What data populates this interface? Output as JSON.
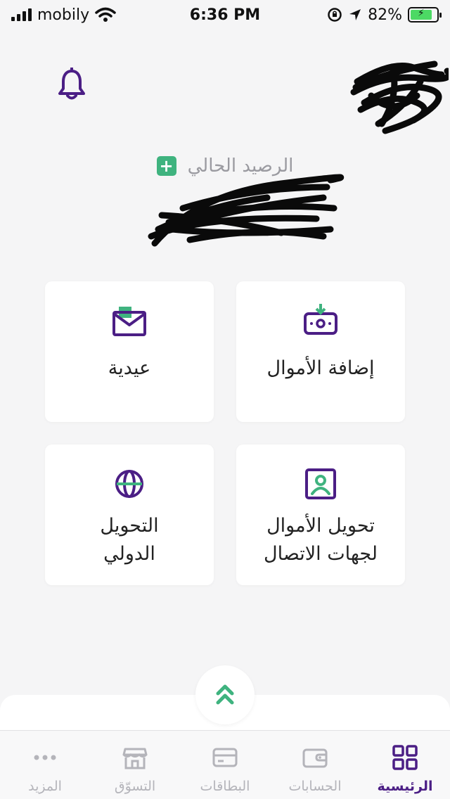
{
  "status_bar": {
    "carrier": "mobily",
    "time": "6:36 PM",
    "battery": "82%",
    "battery_level": 0.82
  },
  "header": {
    "balance_label": "الرصيد الحالي",
    "add_symbol": "+"
  },
  "cards": {
    "add_funds": "إضافة الأموال",
    "eidiya": "عيدية",
    "transfer_contacts_line1": "تحويل الأموال",
    "transfer_contacts_line2": "لجهات الاتصال",
    "international_line1": "التحويل",
    "international_line2": "الدولي"
  },
  "tabs": {
    "home": "الرئيسية",
    "accounts": "الحسابات",
    "cards": "البطاقات",
    "shopping": "التسوّق",
    "more": "المزيد"
  },
  "colors": {
    "brand_purple": "#4b1e85",
    "accent_green": "#3fb37f"
  }
}
